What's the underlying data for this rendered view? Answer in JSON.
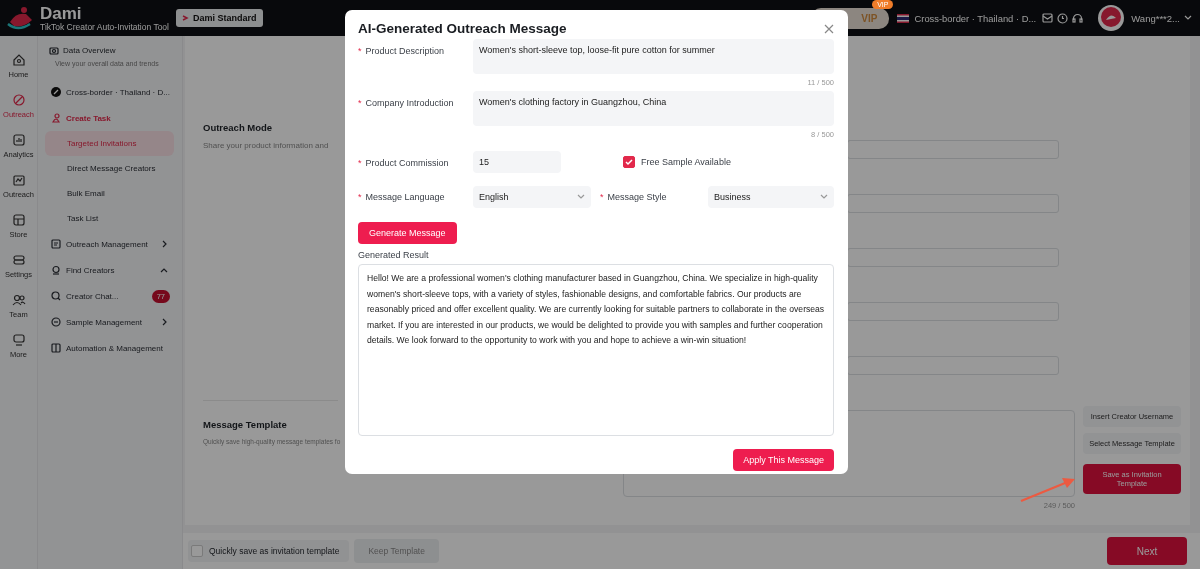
{
  "app": {
    "name": "Dami",
    "tagline": "TikTok Creator Auto-Invitation Tool",
    "plan": "Dami Standard"
  },
  "topbar": {
    "vip_button": "VIP",
    "vip_badge": "VIP",
    "region": "Cross-border · Thailand · D...",
    "user": "Wang***2..."
  },
  "rail": [
    {
      "label": "Home",
      "selected": false
    },
    {
      "label": "Outreach",
      "selected": true
    },
    {
      "label": "Analytics",
      "selected": false
    },
    {
      "label": "Outreach",
      "selected": false
    },
    {
      "label": "Store",
      "selected": false
    },
    {
      "label": "Settings",
      "selected": false
    },
    {
      "label": "Team",
      "selected": false
    },
    {
      "label": "More",
      "selected": false
    }
  ],
  "nav": {
    "overview": {
      "title": "Data Overview",
      "subtitle": "View your overall data and trends"
    },
    "shop": "Cross-border · Thailand · D...",
    "items": [
      {
        "kind": "group",
        "label": "Create Task",
        "selected": true,
        "children": [
          {
            "label": "Targeted Invitations",
            "selected": true
          },
          {
            "label": "Direct Message Creators",
            "selected": false
          },
          {
            "label": "Bulk Email",
            "selected": false
          },
          {
            "label": "Task List",
            "selected": false
          }
        ]
      },
      {
        "kind": "link",
        "label": "Outreach Management",
        "selected": false,
        "expanded": false
      },
      {
        "kind": "link",
        "label": "Find Creators",
        "selected": false,
        "expanded": true
      },
      {
        "kind": "link",
        "label": "Creator Chat...",
        "selected": false,
        "badge": "77"
      },
      {
        "kind": "link",
        "label": "Sample Management",
        "selected": false,
        "expanded": false
      },
      {
        "kind": "link",
        "label": "Automation & Management",
        "selected": false
      }
    ]
  },
  "content": {
    "sections": [
      {
        "title": "Outreach Mode",
        "description": "Share your product information and"
      },
      {
        "title": "Message Template",
        "description": "Quickly save high-quality message templates fo"
      }
    ],
    "template_counter": "249 / 500",
    "template_buttons": [
      {
        "label": "Insert Creator Username",
        "kind": "default"
      },
      {
        "label": "Select Message Template",
        "kind": "default"
      },
      {
        "label": "Save as Invitation Template",
        "kind": "primary"
      }
    ]
  },
  "footer": {
    "quick_save": {
      "label": "Quickly save as invitation template",
      "checked": false
    },
    "keep_button": {
      "label": "Keep Template",
      "disabled": true
    },
    "next_button": "Next"
  },
  "modal": {
    "title": "AI-Generated Outreach Message",
    "fields": [
      {
        "kind": "textarea",
        "mark": "*",
        "label": "Product Description",
        "value": "Women's short-sleeve top, loose-fit pure cotton for summer",
        "counter": "11 / 500"
      },
      {
        "kind": "textarea",
        "mark": "*",
        "label": "Company Introduction",
        "value": "Women's clothing factory in Guangzhou, China",
        "counter": "8 / 500"
      },
      {
        "kind": "input",
        "mark": "*",
        "label": "Product Commission",
        "value": "15",
        "checkbox": {
          "label": "Free Sample Available",
          "checked": true
        }
      },
      {
        "kind": "select-pair",
        "items": [
          {
            "mark": "*",
            "label": "Message Language",
            "value": "English"
          },
          {
            "mark": "*",
            "label": "Message Style",
            "value": "Business"
          }
        ]
      }
    ],
    "generate_button": "Generate Message",
    "result_label": "Generated Result",
    "result": "Hello! We are a professional women's clothing manufacturer based in Guangzhou, China. We specialize in high-quality women's short-sleeve tops, with a variety of styles, fashionable designs, and comfortable fabrics. Our products are reasonably priced and offer excellent quality. We are currently looking for suitable partners to collaborate in the overseas market. If you are interested in our products, we would be delighted to provide you with samples and further cooperation details. We look forward to the opportunity to work with you and hope to achieve a win-win situation!",
    "apply_button": "Apply This Message"
  }
}
